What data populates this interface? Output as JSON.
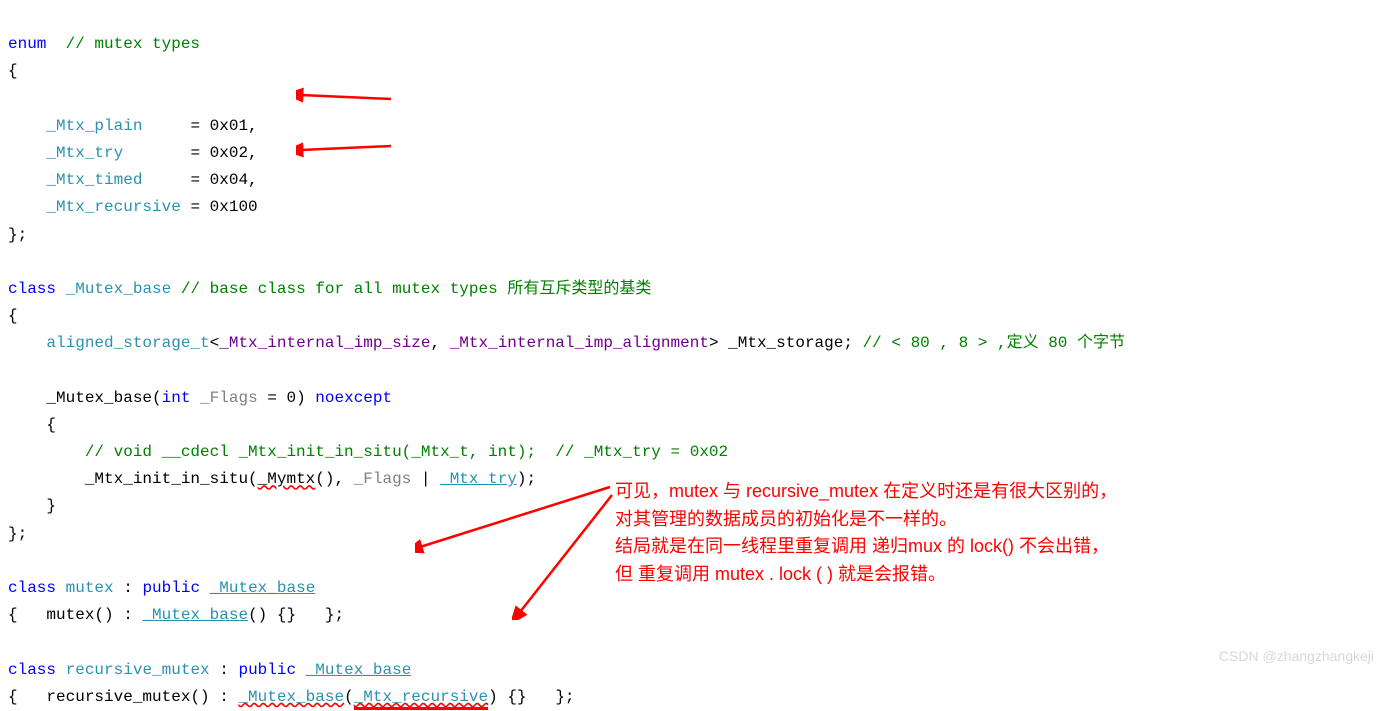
{
  "lines": {
    "l1_enum": "enum",
    "l1_comment": "// mutex types",
    "l2": "{",
    "l3_name": "_Mtx_plain",
    "l3_eq": "= 0x01,",
    "l4_name": "_Mtx_try",
    "l4_eq": "= 0x02,",
    "l5_name": "_Mtx_timed",
    "l5_eq": "= 0x04,",
    "l6_name": "_Mtx_recursive",
    "l6_eq": "= 0x100",
    "l7": "};",
    "l8_class": "class",
    "l8_name": "_Mutex_base",
    "l8_comment": "// base class for all mutex types 所有互斥类型的基类",
    "l9": "{",
    "l10_tpl": "aligned_storage_t",
    "l10_a": "<",
    "l10_p1": "_Mtx_internal_imp_size",
    "l10_c": ", ",
    "l10_p2": "_Mtx_internal_imp_alignment",
    "l10_b": "> ",
    "l10_var": "_Mtx_storage",
    "l10_sc": "; ",
    "l10_comment": "// < 80 , 8 > ,定义 80 个字节",
    "l11_name": "_Mutex_base",
    "l11_a": "(",
    "l11_int": "int",
    "l11_flags": " _Flags",
    "l11_eq": " = 0) ",
    "l11_noexcept": "noexcept",
    "l12": "    {",
    "l13_comment": "// void __cdecl _Mtx_init_in_situ(_Mtx_t, int);  // _Mtx_try = 0x02",
    "l14_fn": "_Mtx_init_in_situ",
    "l14_a": "(",
    "l14_my": "_Mymtx",
    "l14_b": "(), ",
    "l14_flags": "_Flags",
    "l14_pipe": " | ",
    "l14_try": "_Mtx_try",
    "l14_c": ");",
    "l15": "    }",
    "l16": "};",
    "l17_class": "class",
    "l17_name": "mutex",
    "l17_pub": "public",
    "l17_base": "_Mutex_base",
    "l18_a": "{   ",
    "l18_ctor": "mutex",
    "l18_b": "() : ",
    "l18_base": "_Mutex_base",
    "l18_c": "() {}   };",
    "l19_class": "class",
    "l19_name": "recursive_mutex",
    "l19_pub": "public",
    "l19_base": "_Mutex_base",
    "l20_a": "{   ",
    "l20_ctor": "recursive_mutex",
    "l20_b": "() : ",
    "l20_base": "_Mutex_base",
    "l20_c": "(",
    "l20_arg": "_Mtx_recursive",
    "l20_d": ") {}   };"
  },
  "annotation": {
    "l1": "可见，mutex 与 recursive_mutex 在定义时还是有很大区别的，",
    "l2": "对其管理的数据成员的初始化是不一样的。",
    "l3": "结局就是在同一线程里重复调用 递归mux 的 lock() 不会出错，",
    "l4": "但 重复调用 mutex . lock ( ) 就是会报错。"
  },
  "watermark": "CSDN @zhangzhangkeji"
}
